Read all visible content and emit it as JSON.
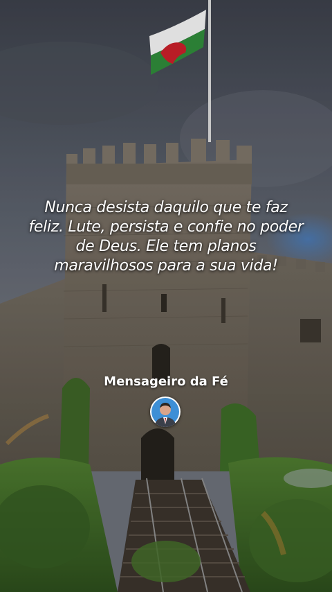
{
  "quote": {
    "text": "Nunca desista daquilo que te faz feliz. Lute, persista e confie no poder de Deus. Ele tem planos maravilhosos para a sua vida!"
  },
  "author": {
    "name": "Mensageiro da Fé"
  },
  "colors": {
    "sky": "#4f5662",
    "stone": "#6d665c",
    "grass": "#3f6b2a",
    "text": "#ffffff"
  }
}
